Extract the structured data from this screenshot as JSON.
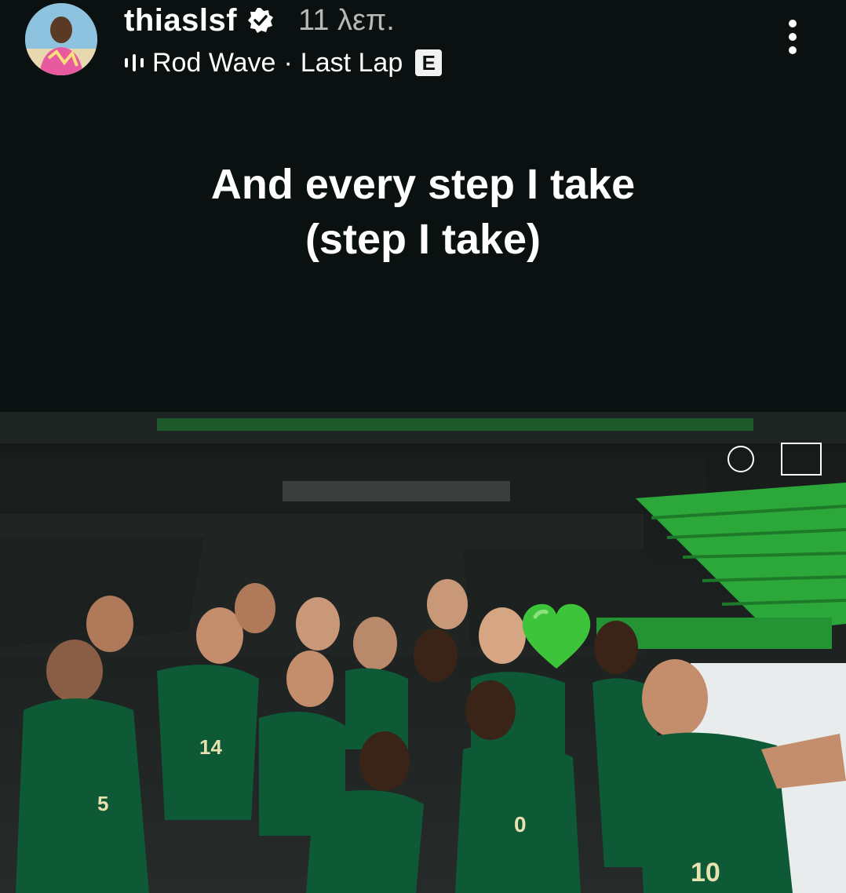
{
  "story": {
    "username": "thiaslsf",
    "timestamp": "11 λεπ.",
    "music": {
      "artist": "Rod Wave",
      "separator": "·",
      "track": "Last Lap",
      "explicit_badge": "E"
    },
    "lyric_lines": [
      "And every step I take",
      "(step I take)"
    ]
  },
  "photo": {
    "jersey_numbers": [
      "5",
      "14",
      "0",
      "10"
    ]
  },
  "icons": {
    "verified": "verified-badge-icon",
    "music": "equalizer-icon",
    "more": "more-vertical-icon",
    "sticker": "green-heart-icon"
  },
  "colors": {
    "background": "#0a1110",
    "accent_green": "#3ec43b",
    "jersey": "#0f5a36"
  }
}
